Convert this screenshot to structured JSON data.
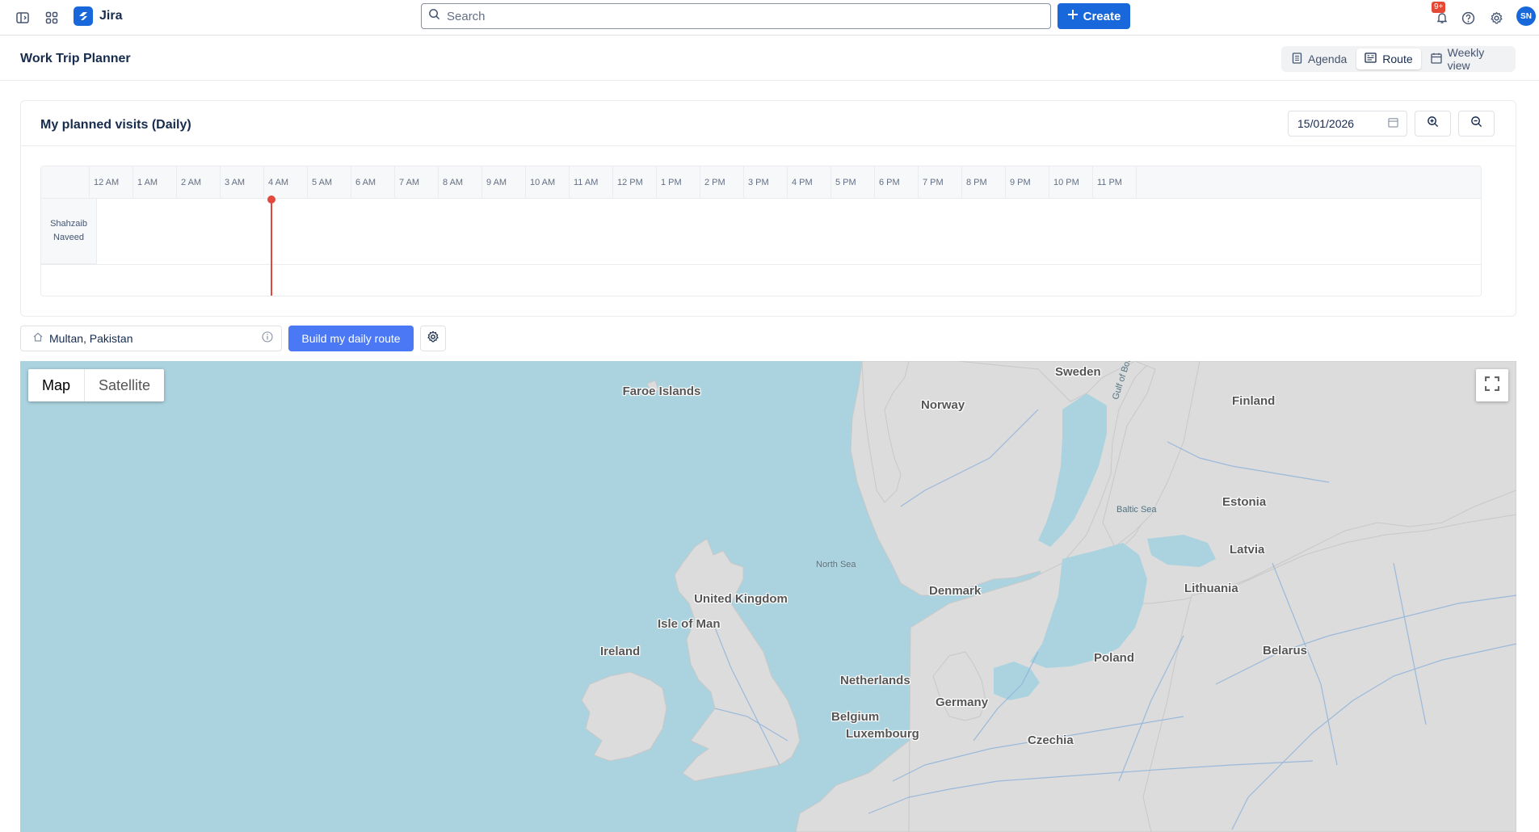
{
  "topbar": {
    "app_name": "Jira",
    "search_placeholder": "Search",
    "create_label": "Create",
    "notifications_badge": "9+",
    "avatar_initials": "SN"
  },
  "page": {
    "title": "Work Trip Planner",
    "views": [
      {
        "label": "Agenda",
        "icon": "document-icon",
        "active": false
      },
      {
        "label": "Route",
        "icon": "map-icon",
        "active": true
      },
      {
        "label": "Weekly view",
        "icon": "calendar-icon",
        "active": false
      }
    ]
  },
  "timeline": {
    "title": "My planned visits (Daily)",
    "date": "15/01/2026",
    "hours": [
      "12 AM",
      "1 AM",
      "2 AM",
      "3 AM",
      "4 AM",
      "5 AM",
      "6 AM",
      "7 AM",
      "8 AM",
      "9 AM",
      "10 AM",
      "11 AM",
      "12 PM",
      "1 PM",
      "2 PM",
      "3 PM",
      "4 PM",
      "5 PM",
      "6 PM",
      "7 PM",
      "8 PM",
      "9 PM",
      "10 PM",
      "11 PM"
    ],
    "person": "Shahzaib Naveed"
  },
  "route": {
    "location": "Multan, Pakistan",
    "build_label": "Build my daily route"
  },
  "map": {
    "type_map": "Map",
    "type_satellite": "Satellite",
    "labels": {
      "sweden": "Sweden",
      "faroe": "Faroe Islands",
      "norway": "Norway",
      "gulf": "Gulf of Bothnia",
      "finland": "Finland",
      "estonia": "Estonia",
      "baltic": "Baltic Sea",
      "latvia": "Latvia",
      "northsea": "North Sea",
      "uk": "United Kingdom",
      "isleofman": "Isle of Man",
      "denmark": "Denmark",
      "lithuania": "Lithuania",
      "ireland": "Ireland",
      "poland": "Poland",
      "belarus": "Belarus",
      "netherlands": "Netherlands",
      "germany": "Germany",
      "belgium": "Belgium",
      "luxembourg": "Luxembourg",
      "czechia": "Czechia"
    }
  }
}
